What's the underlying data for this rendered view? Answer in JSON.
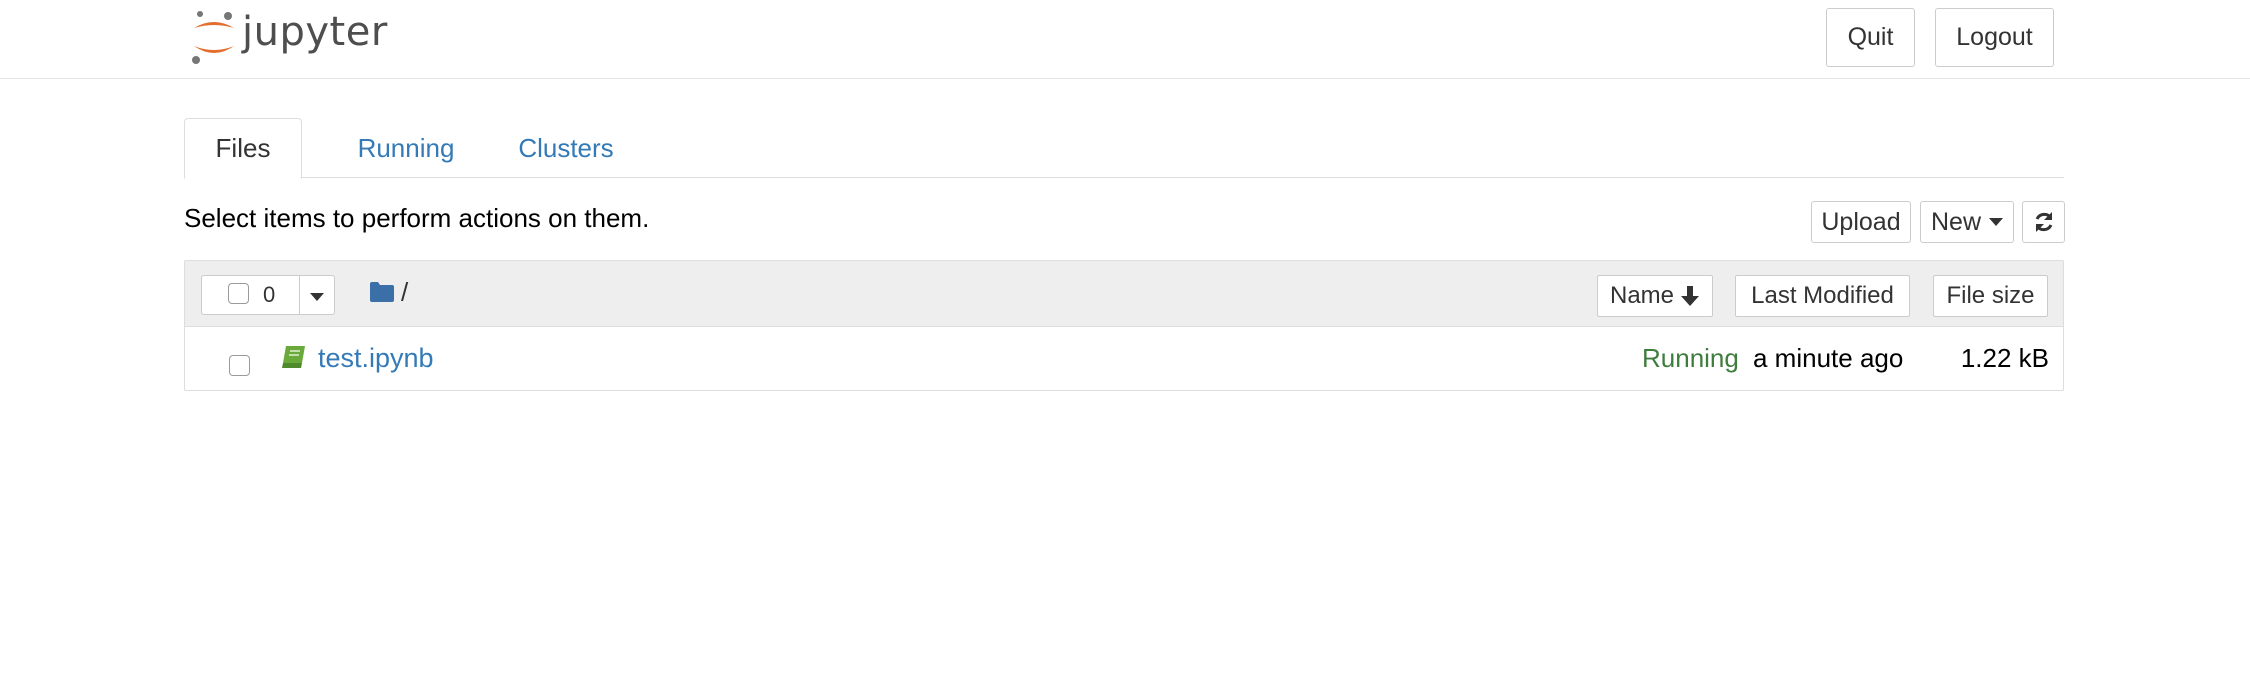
{
  "header": {
    "logo_text": "jupyter",
    "quit_label": "Quit",
    "logout_label": "Logout"
  },
  "tabs": [
    {
      "label": "Files",
      "active": true
    },
    {
      "label": "Running",
      "active": false
    },
    {
      "label": "Clusters",
      "active": false
    }
  ],
  "toolbar": {
    "instructions": "Select items to perform actions on them.",
    "upload_label": "Upload",
    "new_label": "New",
    "refresh_icon": "refresh-icon"
  },
  "list": {
    "selected_count": "0",
    "breadcrumb": "/",
    "sort_name_label": "Name",
    "sort_modified_label": "Last Modified",
    "sort_size_label": "File size",
    "items": [
      {
        "name": "test.ipynb",
        "icon": "notebook-icon",
        "status": "Running",
        "modified": "a minute ago",
        "size": "1.22 kB"
      }
    ]
  },
  "colors": {
    "link": "#337ab7",
    "running": "#3f7d3d",
    "notebook_icon": "#6aaa3a",
    "logo_orange": "#e46e2e"
  }
}
